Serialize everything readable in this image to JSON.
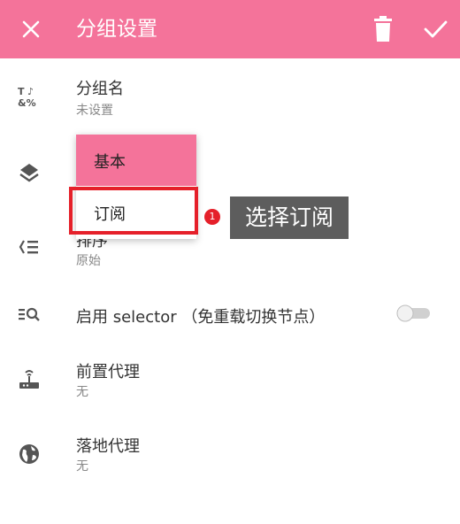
{
  "appbar": {
    "title": "分组设置",
    "bg_color": "#f4739a"
  },
  "rows": {
    "name": {
      "title": "分组名",
      "value": "未设置",
      "icon": "text-format-icon"
    },
    "type": {
      "icon": "layers-icon"
    },
    "sort": {
      "title": "排序",
      "value": "原始",
      "icon": "sort-icon"
    },
    "selector": {
      "title": "启用 selector （免重载切换节点）",
      "icon": "search-list-icon",
      "enabled": false
    },
    "front_proxy": {
      "title": "前置代理",
      "value": "无",
      "icon": "router-icon"
    },
    "landing_proxy": {
      "title": "落地代理",
      "value": "无",
      "icon": "globe-icon"
    }
  },
  "menu": {
    "options": [
      "基本",
      "订阅"
    ],
    "selected": "基本"
  },
  "annotation": {
    "step": "1",
    "text": "选择订阅",
    "color": "#e5202a"
  }
}
